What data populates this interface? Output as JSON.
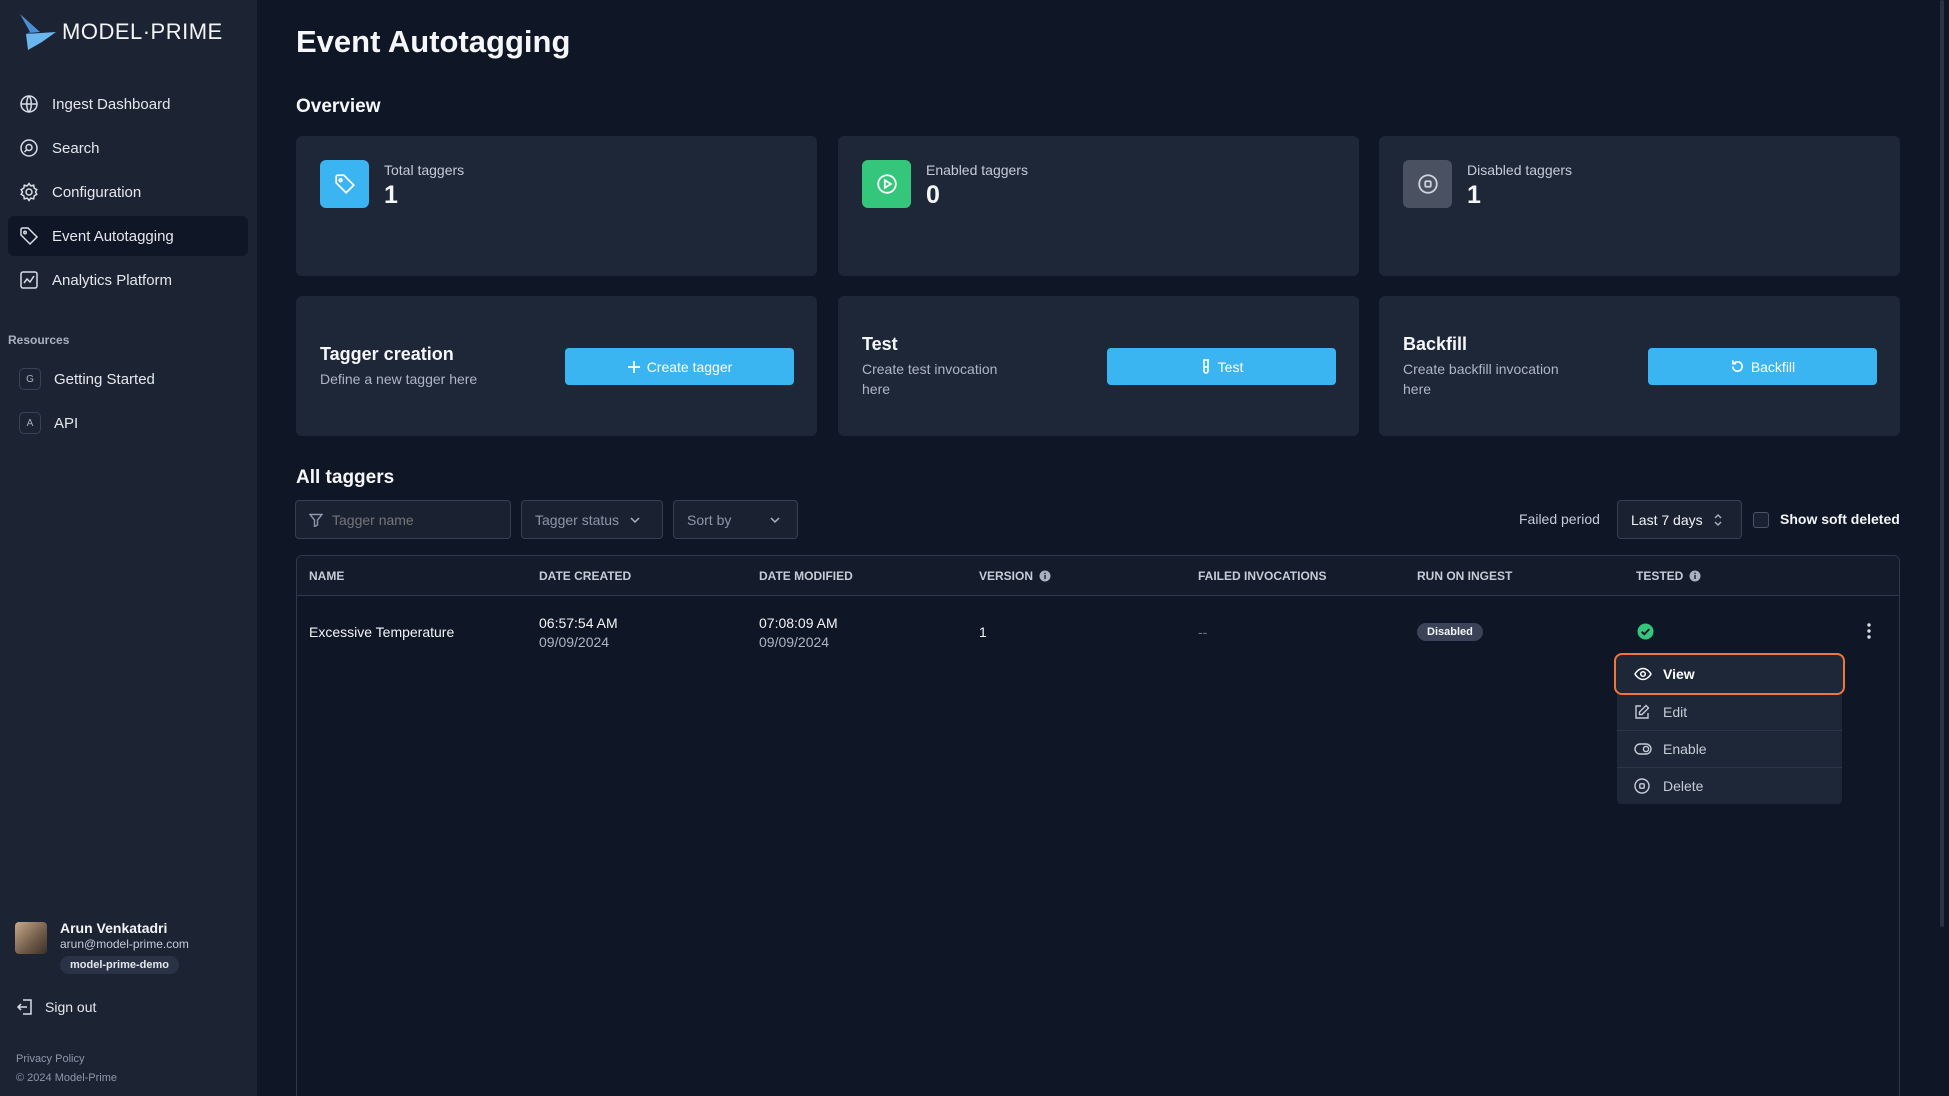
{
  "brand": {
    "name": "MODEL·PRIME"
  },
  "sidebar": {
    "items": [
      {
        "label": "Ingest Dashboard",
        "icon": "globe-icon"
      },
      {
        "label": "Search",
        "icon": "search-icon"
      },
      {
        "label": "Configuration",
        "icon": "gear-icon"
      },
      {
        "label": "Event Autotagging",
        "icon": "tag-icon",
        "active": true
      },
      {
        "label": "Analytics Platform",
        "icon": "chart-icon"
      }
    ],
    "resources_title": "Resources",
    "resources": [
      {
        "letter": "G",
        "label": "Getting Started"
      },
      {
        "letter": "A",
        "label": "API"
      }
    ],
    "user": {
      "name": "Arun Venkatadri",
      "email": "arun@model-prime.com",
      "org": "model-prime-demo"
    },
    "signout": "Sign out",
    "privacy": "Privacy Policy",
    "copyright": "© 2024 Model-Prime"
  },
  "page": {
    "title": "Event Autotagging"
  },
  "overview": {
    "title": "Overview",
    "stats": [
      {
        "label": "Total taggers",
        "value": "1",
        "icon": "tag-icon",
        "color": "#3bb4f2"
      },
      {
        "label": "Enabled taggers",
        "value": "0",
        "icon": "play-circle-icon",
        "color": "#34c77b"
      },
      {
        "label": "Disabled taggers",
        "value": "1",
        "icon": "stop-circle-icon",
        "color": "#4a5262"
      }
    ],
    "actions": [
      {
        "title": "Tagger creation",
        "desc": "Define a new tagger here",
        "button": "Create tagger",
        "icon": "plus-icon"
      },
      {
        "title": "Test",
        "desc": "Create test invocation here",
        "button": "Test",
        "icon": "test-tube-icon"
      },
      {
        "title": "Backfill",
        "desc": "Create backfill invocation here",
        "button": "Backfill",
        "icon": "refresh-icon"
      }
    ]
  },
  "taggers": {
    "title": "All taggers",
    "filters": {
      "name_placeholder": "Tagger name",
      "status_label": "Tagger status",
      "sort_label": "Sort by",
      "failed_period_label": "Failed period",
      "failed_period_value": "Last 7 days",
      "show_soft_deleted": "Show soft deleted"
    },
    "columns": [
      "NAME",
      "DATE CREATED",
      "DATE MODIFIED",
      "VERSION",
      "FAILED INVOCATIONS",
      "RUN ON INGEST",
      "TESTED"
    ],
    "rows": [
      {
        "name": "Excessive Temperature",
        "created_time": "06:57:54 AM",
        "created_date": "09/09/2024",
        "modified_time": "07:08:09 AM",
        "modified_date": "09/09/2024",
        "version": "1",
        "failed_invocations": "--",
        "run_on_ingest": "Disabled",
        "tested": true
      }
    ]
  },
  "row_menu": {
    "items": [
      {
        "label": "View",
        "icon": "eye-icon"
      },
      {
        "label": "Edit",
        "icon": "edit-icon"
      },
      {
        "label": "Enable",
        "icon": "toggle-icon"
      },
      {
        "label": "Delete",
        "icon": "stop-circle-icon"
      }
    ]
  }
}
